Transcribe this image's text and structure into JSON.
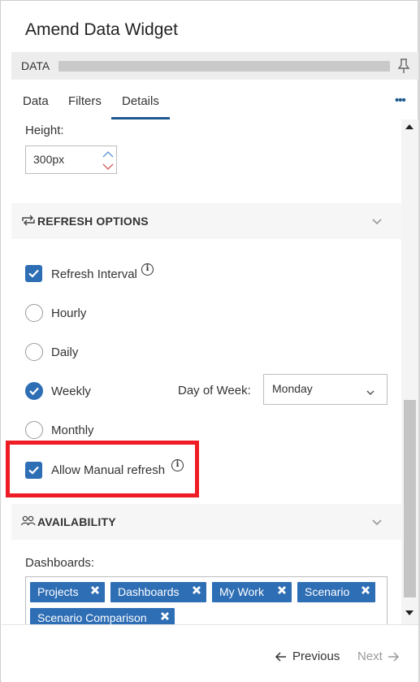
{
  "window": {
    "title": "Amend Data Widget"
  },
  "databar": {
    "label": "DATA"
  },
  "tabs": [
    {
      "label": "Data"
    },
    {
      "label": "Filters"
    },
    {
      "label": "Details",
      "active": true
    }
  ],
  "more_menu": "•••",
  "height": {
    "label": "Height:",
    "value": "300px"
  },
  "refresh": {
    "section_title": "REFRESH OPTIONS",
    "interval_label": "Refresh Interval",
    "interval_checked": true,
    "options": [
      {
        "label": "Hourly",
        "selected": false
      },
      {
        "label": "Daily",
        "selected": false
      },
      {
        "label": "Weekly",
        "selected": true
      },
      {
        "label": "Monthly",
        "selected": false
      }
    ],
    "day_of_week_label": "Day of Week:",
    "day_of_week_value": "Monday",
    "manual_label": "Allow Manual refresh",
    "manual_checked": true
  },
  "availability": {
    "section_title": "AVAILABILITY",
    "dashboards_label": "Dashboards:",
    "tags": [
      "Projects",
      "Dashboards",
      "My Work",
      "Scenario",
      "Scenario Comparison"
    ]
  },
  "footer": {
    "previous_label": "Previous",
    "next_label": "Next"
  },
  "icons": {
    "pin": "pin-icon",
    "refresh": "refresh-icon",
    "availability": "users-icon",
    "info": "info-icon",
    "chevron": "chevron-down-icon",
    "remove": "remove-tag-icon"
  },
  "colors": {
    "accent": "#2e6eb5",
    "tab_underline": "#1f5a8e",
    "highlight": "#ee1c24"
  }
}
